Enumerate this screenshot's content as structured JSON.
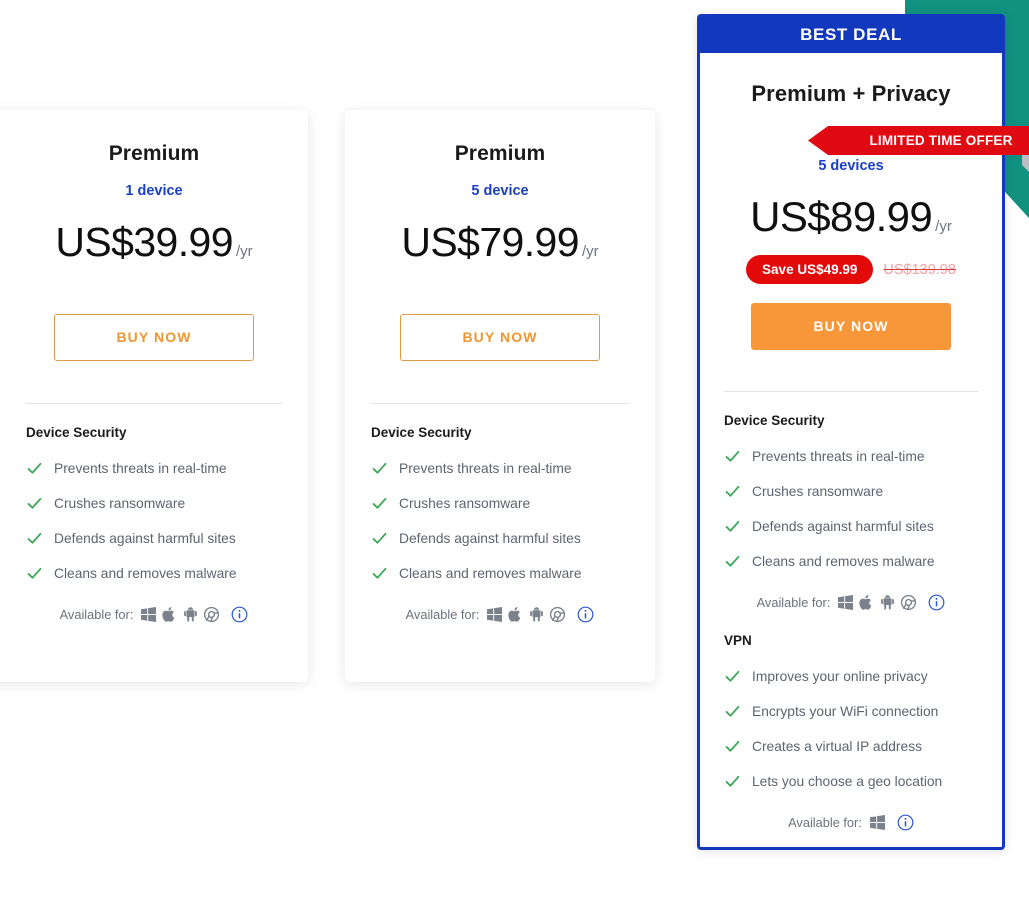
{
  "colors": {
    "brand_blue": "#1238bd",
    "accent_orange": "#f8963a",
    "save_red": "#e30a0a",
    "teal": "#119180",
    "check_green": "#3aa757"
  },
  "decoration": {
    "teal_shape_name": "teal-chevron-decoration"
  },
  "plans": [
    {
      "id": "premium-1-device",
      "name": "Premium",
      "devices": "1 device",
      "price": "US$39.99",
      "per": "/yr",
      "cta": "BUY NOW",
      "sections": [
        {
          "title": "Device Security",
          "features": [
            "Prevents threats in real-time",
            "Crushes ransomware",
            "Defends against harmful sites",
            "Cleans and removes malware"
          ],
          "available_label": "Available for:",
          "platforms": [
            "windows",
            "apple",
            "android",
            "chrome"
          ],
          "info_icon": "info-icon"
        }
      ]
    },
    {
      "id": "premium-5-device",
      "name": "Premium",
      "devices": "5 device",
      "price": "US$79.99",
      "per": "/yr",
      "cta": "BUY NOW",
      "sections": [
        {
          "title": "Device Security",
          "features": [
            "Prevents threats in real-time",
            "Crushes ransomware",
            "Defends against harmful sites",
            "Cleans and removes malware"
          ],
          "available_label": "Available for:",
          "platforms": [
            "windows",
            "apple",
            "android",
            "chrome"
          ],
          "info_icon": "info-icon"
        }
      ]
    }
  ],
  "featured_plan": {
    "id": "premium-plus-privacy",
    "banner": "BEST DEAL",
    "name": "Premium + Privacy",
    "ribbon": "LIMITED TIME OFFER",
    "devices": "5 devices",
    "price": "US$89.99",
    "per": "/yr",
    "save_badge": "Save US$49.99",
    "old_price": "US$139.98",
    "cta": "BUY NOW",
    "sections": [
      {
        "title": "Device Security",
        "features": [
          "Prevents threats in real-time",
          "Crushes ransomware",
          "Defends against harmful sites",
          "Cleans and removes malware"
        ],
        "available_label": "Available for:",
        "platforms": [
          "windows",
          "apple",
          "android",
          "chrome"
        ],
        "info_icon": "info-icon"
      },
      {
        "title": "VPN",
        "features": [
          "Improves your online privacy",
          "Encrypts your WiFi connection",
          "Creates a virtual IP address",
          "Lets you choose a geo location"
        ],
        "available_label": "Available for:",
        "platforms": [
          "windows"
        ],
        "info_icon": "info-icon"
      }
    ]
  }
}
